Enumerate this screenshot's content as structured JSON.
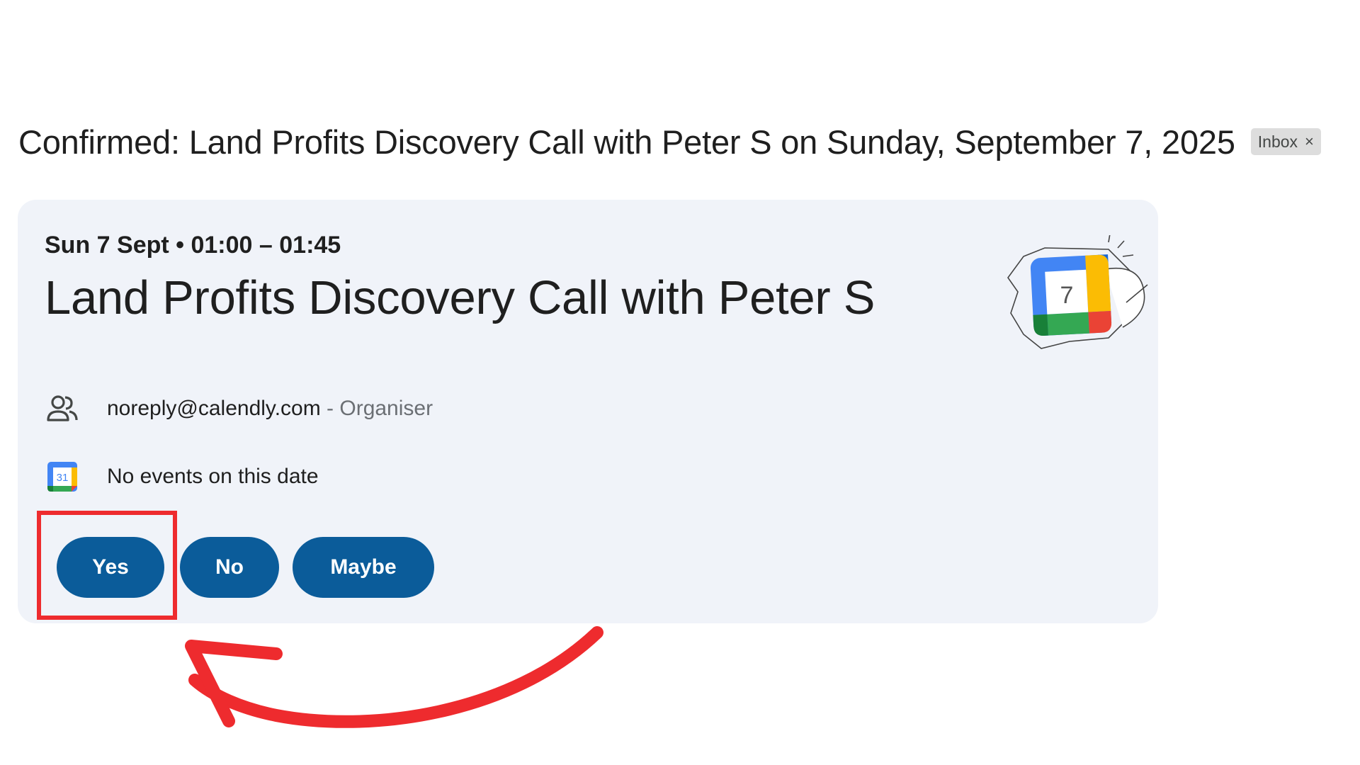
{
  "email": {
    "subject": "Confirmed: Land Profits Discovery Call with Peter S on Sunday, September 7, 2025",
    "label_chip": "Inbox",
    "label_chip_remove": "×"
  },
  "invite": {
    "datetime": "Sun 7 Sept • 01:00 – 01:45",
    "title": "Land Profits Discovery Call with Peter S",
    "illustration_day": "7",
    "organiser_email": "noreply@calendly.com",
    "organiser_role": " - Organiser",
    "calendar_icon_day": "31",
    "calendar_status": "No events on this date",
    "rsvp": {
      "yes_label": "Yes",
      "no_label": "No",
      "maybe_label": "Maybe"
    }
  },
  "colors": {
    "card_bg": "#f0f3f9",
    "rsvp_button": "#0b5c9a",
    "annotation": "#ee2b2e",
    "chip_bg": "#dddddd"
  },
  "icons": {
    "organiser": "people-icon",
    "calendar": "google-calendar-icon",
    "illustration": "google-calendar-illustration"
  }
}
